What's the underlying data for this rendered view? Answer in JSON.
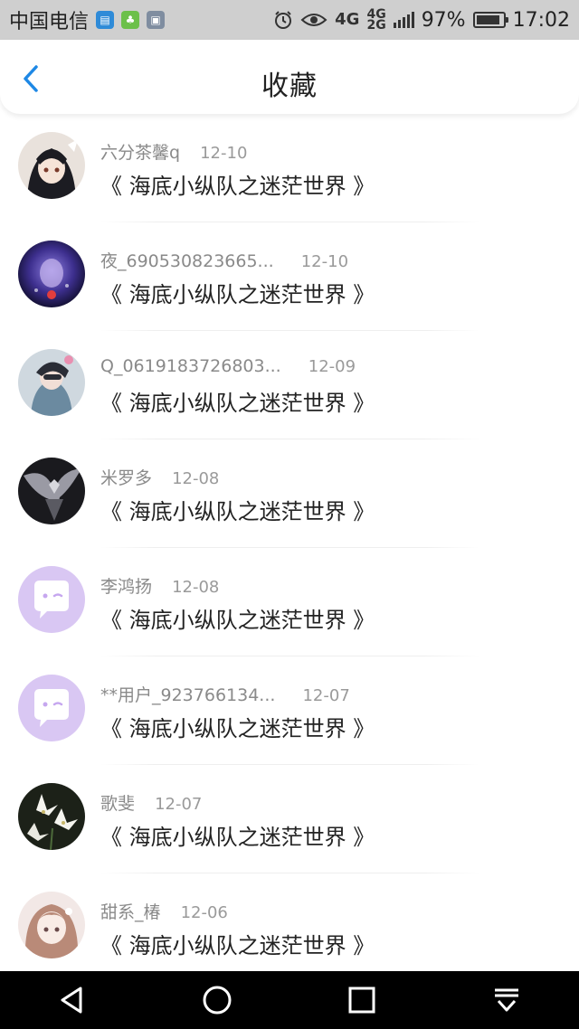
{
  "status_bar": {
    "carrier": "中国电信",
    "network_4g": "4G",
    "network_4g2g_top": "4G",
    "network_4g2g_bottom": "2G",
    "battery": "97%",
    "time": "17:02",
    "apps": [
      "calendar-app-icon",
      "chat-app-icon",
      "gallery-app-icon"
    ]
  },
  "header": {
    "title": "收藏"
  },
  "favorites": [
    {
      "name": "六分茶馨q",
      "date": "12-10",
      "title": "《 海底小纵队之迷茫世界 》"
    },
    {
      "name": "夜_690530823665...",
      "date": "12-10",
      "title": "《 海底小纵队之迷茫世界 》"
    },
    {
      "name": "Q_0619183726803...",
      "date": "12-09",
      "title": "《 海底小纵队之迷茫世界 》"
    },
    {
      "name": "米罗多",
      "date": "12-08",
      "title": "《 海底小纵队之迷茫世界 》"
    },
    {
      "name": "李鸿扬",
      "date": "12-08",
      "title": "《 海底小纵队之迷茫世界 》"
    },
    {
      "name": "**用户_923766134...",
      "date": "12-07",
      "title": "《 海底小纵队之迷茫世界 》"
    },
    {
      "name": "歌斐",
      "date": "12-07",
      "title": "《 海底小纵队之迷茫世界 》"
    },
    {
      "name": "甜系_椿",
      "date": "12-06",
      "title": "《 海底小纵队之迷茫世界 》"
    }
  ],
  "colors": {
    "accent": "#1e88e5",
    "default_avatar_bg": "#d9c7f3"
  }
}
